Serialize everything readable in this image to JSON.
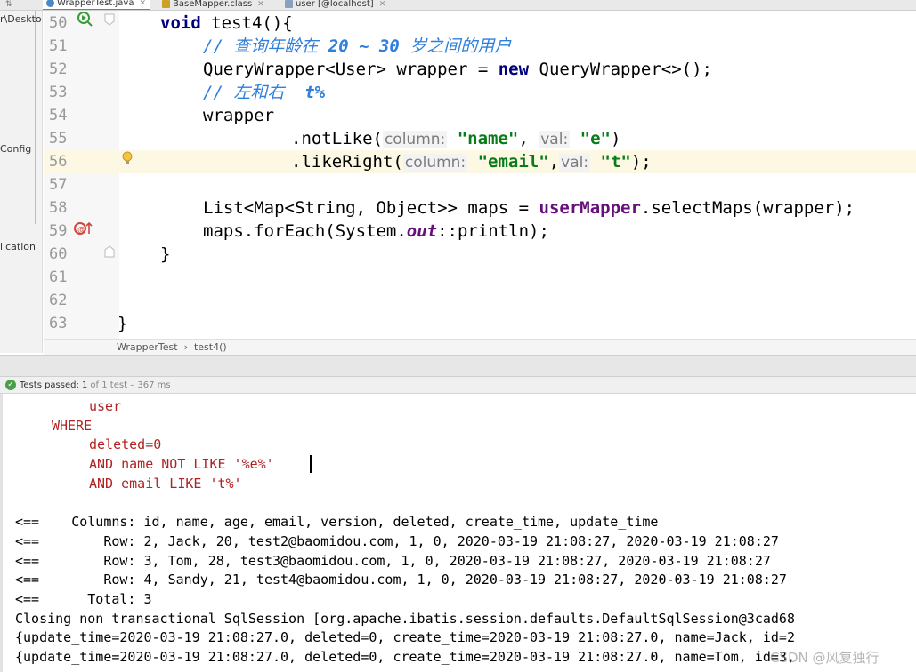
{
  "tabs": [
    {
      "label": "WrapperTest.java",
      "active": true,
      "icon_color": "#4a88c7"
    },
    {
      "label": "BaseMapper.class",
      "active": false,
      "icon_color": "#c9a227"
    },
    {
      "label": "user [@localhost]",
      "active": false,
      "icon_color": "#8aa0c0"
    }
  ],
  "project_panel": {
    "items": [
      "r\\Desktop",
      "Config",
      "lication"
    ]
  },
  "editor": {
    "line_numbers": [
      "50",
      "51",
      "52",
      "53",
      "54",
      "55",
      "56",
      "57",
      "58",
      "59",
      "60",
      "61",
      "62",
      "63"
    ],
    "line50": {
      "kw": "void",
      "rest": " test4(){"
    },
    "line51": {
      "comment_a": "// 查询年龄在 ",
      "comment_b": "20 ~ 30",
      "comment_c": " 岁之间的用户"
    },
    "line52": {
      "a": "QueryWrapper<User> wrapper = ",
      "kw": "new",
      "b": " QueryWrapper<>();"
    },
    "line53": {
      "comment_a": "// 左和右  ",
      "comment_b": "t%"
    },
    "line54": {
      "text": "wrapper"
    },
    "line55": {
      "method": ".notLike(",
      "hint1": "column:",
      "str1": "\"name\"",
      "sep": ", ",
      "hint2": "val:",
      "str2": "\"e\"",
      "end": ")"
    },
    "line56": {
      "method": ".likeRight(",
      "hint1": "column:",
      "str1": "\"email\"",
      "sep": ",",
      "hint2": "val:",
      "str2": "\"t\"",
      "end": ");"
    },
    "line58": {
      "a": "List<Map<String, Object>> maps = ",
      "field": "userMapper",
      "b": ".selectMaps(wrapper);"
    },
    "line59": {
      "a": "maps.forEach(System.",
      "field": "out",
      "b": "::println);"
    },
    "line60": {
      "text": "}"
    },
    "line63": {
      "text": "}"
    }
  },
  "breadcrumb": {
    "items": [
      "WrapperTest",
      "›",
      "test4()"
    ]
  },
  "run_panel": {
    "status_label": "Tests passed:",
    "passed_count": "1",
    "detail": "of 1 test – 367 ms"
  },
  "console": {
    "sql_lines": [
      {
        "text": "user",
        "indent": 2
      },
      {
        "text": "WHERE",
        "indent": 1
      },
      {
        "text": "deleted=0",
        "indent": 2
      },
      {
        "text": "AND name NOT LIKE '%e%'",
        "indent": 2
      },
      {
        "text": "AND email LIKE 't%'",
        "indent": 2
      }
    ],
    "log_lines": [
      "<==    Columns: id, name, age, email, version, deleted, create_time, update_time",
      "<==        Row: 2, Jack, 20, test2@baomidou.com, 1, 0, 2020-03-19 21:08:27, 2020-03-19 21:08:27",
      "<==        Row: 3, Tom, 28, test3@baomidou.com, 1, 0, 2020-03-19 21:08:27, 2020-03-19 21:08:27",
      "<==        Row: 4, Sandy, 21, test4@baomidou.com, 1, 0, 2020-03-19 21:08:27, 2020-03-19 21:08:27",
      "<==      Total: 3",
      "Closing non transactional SqlSession [org.apache.ibatis.session.defaults.DefaultSqlSession@3cad68",
      "{update_time=2020-03-19 21:08:27.0, deleted=0, create_time=2020-03-19 21:08:27.0, name=Jack, id=2",
      "{update_time=2020-03-19 21:08:27.0, deleted=0, create_time=2020-03-19 21:08:27.0, name=Tom, id=3,"
    ],
    "watermark": "CSDN @风复独行"
  },
  "colors": {
    "keyword": "#000080",
    "comment": "#2f7fdc",
    "string": "#067d17",
    "field": "#660e7a",
    "sql": "#b22222",
    "current_line": "#fcf8e3"
  }
}
